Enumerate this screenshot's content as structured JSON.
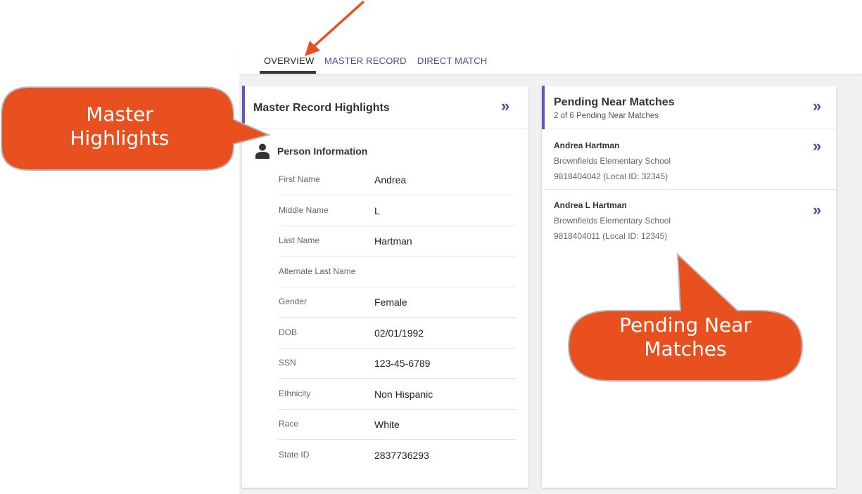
{
  "tabs": [
    {
      "label": "OVERVIEW",
      "active": true
    },
    {
      "label": "MASTER RECORD",
      "active": false
    },
    {
      "label": "DIRECT MATCH",
      "active": false
    }
  ],
  "highlights": {
    "title": "Master Record Highlights",
    "section_title": "Person Information",
    "fields": [
      {
        "label": "First Name",
        "value": "Andrea"
      },
      {
        "label": "Middle Name",
        "value": "L"
      },
      {
        "label": "Last Name",
        "value": "Hartman"
      },
      {
        "label": "Alternate Last Name",
        "value": ""
      },
      {
        "label": "Gender",
        "value": "Female"
      },
      {
        "label": "DOB",
        "value": "02/01/1992"
      },
      {
        "label": "SSN",
        "value": "123-45-6789"
      },
      {
        "label": "Ethnicity",
        "value": "Non Hispanic"
      },
      {
        "label": "Race",
        "value": "White"
      },
      {
        "label": "State ID",
        "value": "2837736293"
      }
    ]
  },
  "near_matches": {
    "title": "Pending Near Matches",
    "subtitle": "2 of 6 Pending Near Matches",
    "items": [
      {
        "name": "Andrea Hartman",
        "school": "Brownfields Elementary School",
        "id": "9818404042 (Local ID: 32345)"
      },
      {
        "name": "Andrea L Hartman",
        "school": "Brownfields Elementary School",
        "id": "9818404011 (Local ID: 12345)"
      }
    ]
  },
  "icons": {
    "chevron": "»",
    "expand_icon": "double-chevron-right-icon",
    "person_icon": "person-icon"
  },
  "callouts": {
    "left": [
      "Master",
      "Highlights"
    ],
    "right": [
      "Pending Near",
      "Matches"
    ]
  },
  "colors": {
    "accent": "#5b5bb5",
    "callout": "#e8511f",
    "arrow": "#e8511f"
  }
}
